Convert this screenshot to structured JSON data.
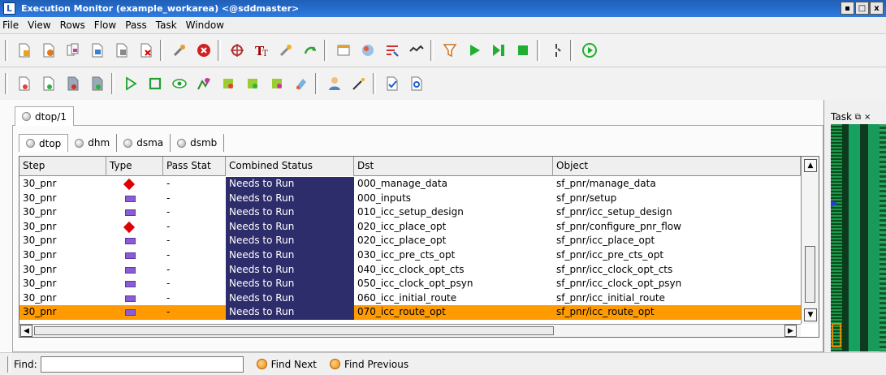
{
  "window": {
    "app_letter": "L",
    "title": "Execution Monitor (example_workarea) <@sddmaster>",
    "controls": [
      "▪",
      "□",
      "x"
    ]
  },
  "menu": [
    "File",
    "View",
    "Rows",
    "Flow",
    "Pass",
    "Task",
    "Window"
  ],
  "outer_tab": {
    "label": "dtop/1"
  },
  "inner_tabs": [
    {
      "label": "dtop",
      "active": true
    },
    {
      "label": "dhm",
      "active": false
    },
    {
      "label": "dsma",
      "active": false
    },
    {
      "label": "dsmb",
      "active": false
    }
  ],
  "table": {
    "columns": [
      "Step",
      "Type",
      "Pass Stat",
      "Combined Status",
      "Dst",
      "Object"
    ],
    "rows": [
      {
        "step": "30_pnr",
        "type": "diamond",
        "pass": "-",
        "status": "Needs to Run",
        "dst": "000_manage_data",
        "object": "sf_pnr/manage_data"
      },
      {
        "step": "30_pnr",
        "type": "rect",
        "pass": "-",
        "status": "Needs to Run",
        "dst": "000_inputs",
        "object": "sf_pnr/setup"
      },
      {
        "step": "30_pnr",
        "type": "rect",
        "pass": "-",
        "status": "Needs to Run",
        "dst": "010_icc_setup_design",
        "object": "sf_pnr/icc_setup_design"
      },
      {
        "step": "30_pnr",
        "type": "diamond",
        "pass": "-",
        "status": "Needs to Run",
        "dst": "020_icc_place_opt",
        "object": "sf_pnr/configure_pnr_flow"
      },
      {
        "step": "30_pnr",
        "type": "rect",
        "pass": "-",
        "status": "Needs to Run",
        "dst": "020_icc_place_opt",
        "object": "sf_pnr/icc_place_opt"
      },
      {
        "step": "30_pnr",
        "type": "rect",
        "pass": "-",
        "status": "Needs to Run",
        "dst": "030_icc_pre_cts_opt",
        "object": "sf_pnr/icc_pre_cts_opt"
      },
      {
        "step": "30_pnr",
        "type": "rect",
        "pass": "-",
        "status": "Needs to Run",
        "dst": "040_icc_clock_opt_cts",
        "object": "sf_pnr/icc_clock_opt_cts"
      },
      {
        "step": "30_pnr",
        "type": "rect",
        "pass": "-",
        "status": "Needs to Run",
        "dst": "050_icc_clock_opt_psyn",
        "object": "sf_pnr/icc_clock_opt_psyn"
      },
      {
        "step": "30_pnr",
        "type": "rect",
        "pass": "-",
        "status": "Needs to Run",
        "dst": "060_icc_initial_route",
        "object": "sf_pnr/icc_initial_route"
      },
      {
        "step": "30_pnr",
        "type": "rect",
        "pass": "-",
        "status": "Needs to Run",
        "dst": "070_icc_route_opt",
        "object": "sf_pnr/icc_route_opt",
        "selected": true
      }
    ]
  },
  "find": {
    "label": "Find:",
    "value": "",
    "next_label": "Find Next",
    "prev_label": "Find Previous"
  },
  "dock": {
    "title": "Task",
    "float_glyph": "⧉",
    "close_glyph": "×"
  },
  "colors": {
    "status_bg": "#2e2d6b",
    "selected_row": "#ff9a00",
    "diamond": "#e00000",
    "rect": "#8a5cd6"
  },
  "toolbar1_icons": [
    "new-doc-icon",
    "open-doc-icon",
    "copy-doc-icon",
    "save-doc-icon",
    "delete-doc-icon",
    "close-doc-icon",
    "tools-icon",
    "stop-icon",
    "debug-icon",
    "font-icon",
    "wrench-icon",
    "refresh-icon",
    "window-icon",
    "color-icon",
    "flow-icon",
    "run-icon",
    "play-icon",
    "step-icon",
    "stop-square-icon",
    "pause-icon",
    "go-icon"
  ],
  "toolbar2_icons": [
    "task-a-icon",
    "task-b-icon",
    "task-c-icon",
    "task-d-icon",
    "play-outline-icon",
    "square-outline-icon",
    "eye-icon",
    "graph-icon",
    "cube-a-icon",
    "cube-b-icon",
    "cube-c-icon",
    "paint-icon",
    "user-icon",
    "wand-icon",
    "doc-check-icon",
    "doc-search-icon"
  ]
}
